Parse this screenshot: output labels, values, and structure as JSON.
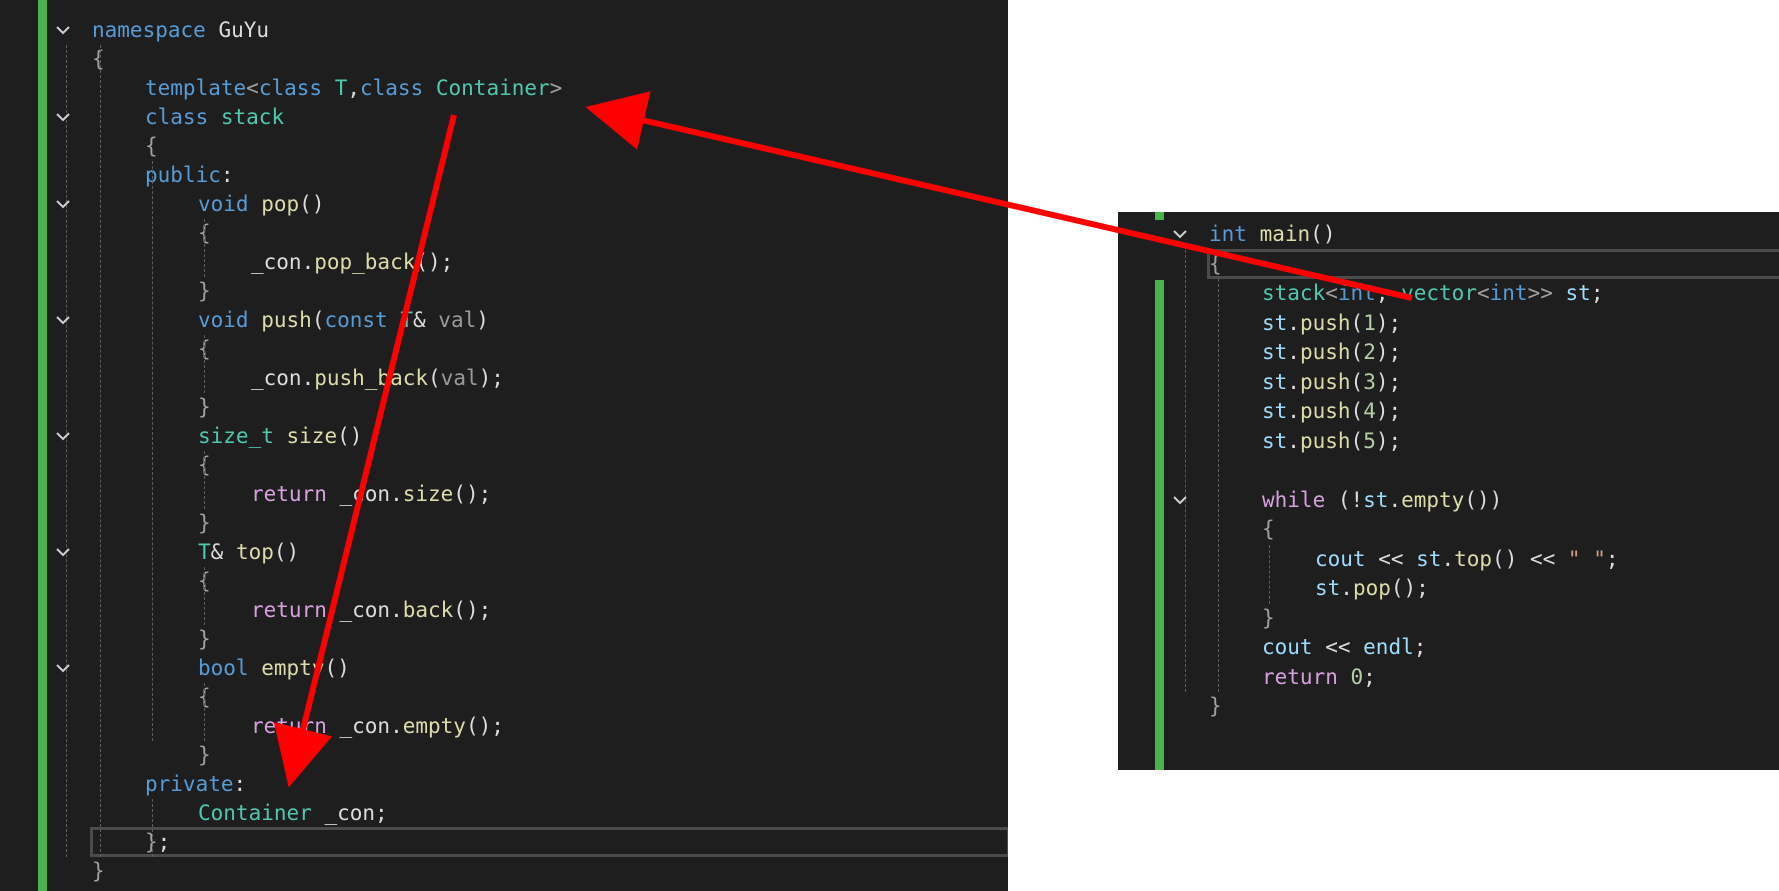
{
  "left_editor": {
    "lines": [
      {
        "id": "l1",
        "parts": [
          [
            "kw",
            "namespace"
          ],
          [
            "pl",
            " GuYu"
          ]
        ]
      },
      {
        "id": "l2",
        "parts": [
          [
            "br",
            "{"
          ]
        ]
      },
      {
        "id": "l3",
        "parts": [
          [
            "kw",
            "template"
          ],
          [
            "br",
            "<"
          ],
          [
            "kw",
            "class"
          ],
          [
            "pl",
            " "
          ],
          [
            "ty",
            "T"
          ],
          [
            "pl",
            ","
          ],
          [
            "kw",
            "class"
          ],
          [
            "pl",
            " "
          ],
          [
            "ty",
            "Container"
          ],
          [
            "br",
            ">"
          ]
        ]
      },
      {
        "id": "l4",
        "parts": [
          [
            "kw",
            "class"
          ],
          [
            "pl",
            " "
          ],
          [
            "ty",
            "stack"
          ]
        ]
      },
      {
        "id": "l5",
        "parts": [
          [
            "br",
            "{"
          ]
        ]
      },
      {
        "id": "l6",
        "parts": [
          [
            "kw",
            "public"
          ],
          [
            "pl",
            ":"
          ]
        ]
      },
      {
        "id": "l7",
        "parts": [
          [
            "kw",
            "void"
          ],
          [
            "pl",
            " "
          ],
          [
            "fn",
            "pop"
          ],
          [
            "pl",
            "()"
          ]
        ]
      },
      {
        "id": "l8",
        "parts": [
          [
            "br",
            "{"
          ]
        ]
      },
      {
        "id": "l9",
        "parts": [
          [
            "pl",
            "_con."
          ],
          [
            "fn",
            "pop_back"
          ],
          [
            "pl",
            "();"
          ]
        ]
      },
      {
        "id": "l10",
        "parts": [
          [
            "br",
            "}"
          ]
        ]
      },
      {
        "id": "l11",
        "parts": [
          [
            "kw",
            "void"
          ],
          [
            "pl",
            " "
          ],
          [
            "fn",
            "push"
          ],
          [
            "pl",
            "("
          ],
          [
            "kw",
            "const"
          ],
          [
            "pl",
            " "
          ],
          [
            "ty",
            "T"
          ],
          [
            "pl",
            "& "
          ],
          [
            "pm",
            "val"
          ],
          [
            "pl",
            ")"
          ]
        ]
      },
      {
        "id": "l12",
        "parts": [
          [
            "br",
            "{"
          ]
        ]
      },
      {
        "id": "l13",
        "parts": [
          [
            "pl",
            "_con."
          ],
          [
            "fn",
            "push_back"
          ],
          [
            "pl",
            "("
          ],
          [
            "pm",
            "val"
          ],
          [
            "pl",
            ");"
          ]
        ]
      },
      {
        "id": "l14",
        "parts": [
          [
            "br",
            "}"
          ]
        ]
      },
      {
        "id": "l15",
        "parts": [
          [
            "ty",
            "size_t"
          ],
          [
            "pl",
            " "
          ],
          [
            "fn",
            "size"
          ],
          [
            "pl",
            "()"
          ]
        ]
      },
      {
        "id": "l16",
        "parts": [
          [
            "br",
            "{"
          ]
        ]
      },
      {
        "id": "l17",
        "parts": [
          [
            "kw2",
            "return"
          ],
          [
            "pl",
            " _con."
          ],
          [
            "fn",
            "size"
          ],
          [
            "pl",
            "();"
          ]
        ]
      },
      {
        "id": "l18",
        "parts": [
          [
            "br",
            "}"
          ]
        ]
      },
      {
        "id": "l19",
        "parts": [
          [
            "ty",
            "T"
          ],
          [
            "pl",
            "& "
          ],
          [
            "fn",
            "top"
          ],
          [
            "pl",
            "()"
          ]
        ]
      },
      {
        "id": "l20",
        "parts": [
          [
            "br",
            "{"
          ]
        ]
      },
      {
        "id": "l21",
        "parts": [
          [
            "kw2",
            "return"
          ],
          [
            "pl",
            " _con."
          ],
          [
            "fn",
            "back"
          ],
          [
            "pl",
            "();"
          ]
        ]
      },
      {
        "id": "l22",
        "parts": [
          [
            "br",
            "}"
          ]
        ]
      },
      {
        "id": "l23",
        "parts": [
          [
            "kw",
            "bool"
          ],
          [
            "pl",
            " "
          ],
          [
            "fn",
            "empty"
          ],
          [
            "pl",
            "()"
          ]
        ]
      },
      {
        "id": "l24",
        "parts": [
          [
            "br",
            "{"
          ]
        ]
      },
      {
        "id": "l25",
        "parts": [
          [
            "kw2",
            "return"
          ],
          [
            "pl",
            " _con."
          ],
          [
            "fn",
            "empty"
          ],
          [
            "pl",
            "();"
          ]
        ]
      },
      {
        "id": "l26",
        "parts": [
          [
            "br",
            "}"
          ]
        ]
      },
      {
        "id": "l27",
        "parts": [
          [
            "kw",
            "private"
          ],
          [
            "pl",
            ":"
          ]
        ]
      },
      {
        "id": "l28",
        "parts": [
          [
            "ty",
            "Container"
          ],
          [
            "pl",
            " _con;"
          ]
        ]
      },
      {
        "id": "l29",
        "parts": [
          [
            "br",
            "}"
          ],
          [
            "pl",
            ";"
          ]
        ]
      },
      {
        "id": "l30",
        "parts": [
          [
            "br",
            "}"
          ]
        ]
      }
    ]
  },
  "right_editor": {
    "lines": [
      {
        "id": "r1",
        "parts": [
          [
            "kw",
            "int"
          ],
          [
            "pl",
            " "
          ],
          [
            "fn",
            "main"
          ],
          [
            "pl",
            "()"
          ]
        ]
      },
      {
        "id": "r2",
        "parts": [
          [
            "br",
            "{"
          ]
        ]
      },
      {
        "id": "r3",
        "parts": [
          [
            "ty",
            "stack"
          ],
          [
            "br",
            "<"
          ],
          [
            "kw",
            "int"
          ],
          [
            "pl",
            ", "
          ],
          [
            "ty",
            "vector"
          ],
          [
            "br",
            "<"
          ],
          [
            "kw",
            "int"
          ],
          [
            "br",
            ">>"
          ],
          [
            "pl",
            " "
          ],
          [
            "vr",
            "st"
          ],
          [
            "pl",
            ";"
          ]
        ]
      },
      {
        "id": "r4",
        "parts": [
          [
            "vr",
            "st"
          ],
          [
            "pl",
            "."
          ],
          [
            "fn",
            "push"
          ],
          [
            "pl",
            "("
          ],
          [
            "nm",
            "1"
          ],
          [
            "pl",
            ");"
          ]
        ]
      },
      {
        "id": "r5",
        "parts": [
          [
            "vr",
            "st"
          ],
          [
            "pl",
            "."
          ],
          [
            "fn",
            "push"
          ],
          [
            "pl",
            "("
          ],
          [
            "nm",
            "2"
          ],
          [
            "pl",
            ");"
          ]
        ]
      },
      {
        "id": "r6",
        "parts": [
          [
            "vr",
            "st"
          ],
          [
            "pl",
            "."
          ],
          [
            "fn",
            "push"
          ],
          [
            "pl",
            "("
          ],
          [
            "nm",
            "3"
          ],
          [
            "pl",
            ");"
          ]
        ]
      },
      {
        "id": "r7",
        "parts": [
          [
            "vr",
            "st"
          ],
          [
            "pl",
            "."
          ],
          [
            "fn",
            "push"
          ],
          [
            "pl",
            "("
          ],
          [
            "nm",
            "4"
          ],
          [
            "pl",
            ");"
          ]
        ]
      },
      {
        "id": "r8",
        "parts": [
          [
            "vr",
            "st"
          ],
          [
            "pl",
            "."
          ],
          [
            "fn",
            "push"
          ],
          [
            "pl",
            "("
          ],
          [
            "nm",
            "5"
          ],
          [
            "pl",
            ");"
          ]
        ]
      },
      {
        "id": "r9",
        "parts": [
          [
            "pl",
            ""
          ]
        ]
      },
      {
        "id": "r10",
        "parts": [
          [
            "kw2",
            "while"
          ],
          [
            "pl",
            " (!"
          ],
          [
            "vr",
            "st"
          ],
          [
            "pl",
            "."
          ],
          [
            "fn",
            "empty"
          ],
          [
            "pl",
            "())"
          ]
        ]
      },
      {
        "id": "r11",
        "parts": [
          [
            "br",
            "{"
          ]
        ]
      },
      {
        "id": "r12",
        "parts": [
          [
            "vr",
            "cout"
          ],
          [
            "pl",
            " << "
          ],
          [
            "vr",
            "st"
          ],
          [
            "pl",
            "."
          ],
          [
            "fn",
            "top"
          ],
          [
            "pl",
            "() << "
          ],
          [
            "st",
            "\" \""
          ],
          [
            "pl",
            ";"
          ]
        ]
      },
      {
        "id": "r13",
        "parts": [
          [
            "vr",
            "st"
          ],
          [
            "pl",
            "."
          ],
          [
            "fn",
            "pop"
          ],
          [
            "pl",
            "();"
          ]
        ]
      },
      {
        "id": "r14",
        "parts": [
          [
            "br",
            "}"
          ]
        ]
      },
      {
        "id": "r15",
        "parts": [
          [
            "vr",
            "cout"
          ],
          [
            "pl",
            " << "
          ],
          [
            "vr",
            "endl"
          ],
          [
            "pl",
            ";"
          ]
        ]
      },
      {
        "id": "r16",
        "parts": [
          [
            "kw2",
            "return"
          ],
          [
            "pl",
            " "
          ],
          [
            "nm",
            "0"
          ],
          [
            "pl",
            ";"
          ]
        ]
      },
      {
        "id": "r17",
        "parts": [
          [
            "br",
            "}"
          ]
        ]
      }
    ]
  },
  "colors": {
    "editor_bg": "#1e1e1e",
    "change_bar": "#4ab24a",
    "arrow": "#ff0000"
  },
  "icons": {
    "fold": "chevron-down-icon",
    "annotation": "arrow-icon"
  }
}
